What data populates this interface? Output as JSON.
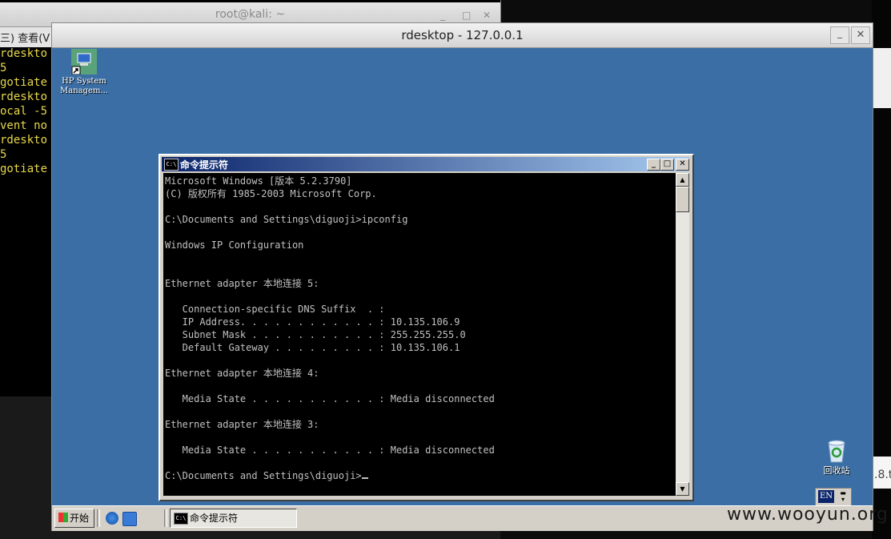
{
  "kali": {
    "title": "root@kali: ~",
    "controls": {
      "minimize": "_",
      "maximize": "□",
      "close": "✕"
    },
    "menu": "三)  查看(V",
    "lines": [
      " rdeskto",
      "5",
      "gotiate",
      " rdeskto",
      "ocal -5",
      "vent no",
      " rdeskto",
      "5",
      "gotiate"
    ]
  },
  "right_edge_text": ".8.t",
  "rdesktop": {
    "title": "rdesktop - 127.0.0.1",
    "minimize": "_",
    "close": "✕"
  },
  "desktop_icons": [
    {
      "label": "HP System Managem...",
      "icon": "hp-system-management-icon"
    },
    {
      "label": "回收站",
      "icon": "recycle-bin-icon"
    }
  ],
  "cmd": {
    "title": "命令提示符",
    "title_icon_text": "C:\\",
    "lines": [
      "Microsoft Windows [版本 5.2.3790]",
      "(C) 版权所有 1985-2003 Microsoft Corp.",
      "",
      "C:\\Documents and Settings\\diguoji>ipconfig",
      "",
      "Windows IP Configuration",
      "",
      "",
      "Ethernet adapter 本地连接 5:",
      "",
      "   Connection-specific DNS Suffix  . :",
      "   IP Address. . . . . . . . . . . . : 10.135.106.9",
      "   Subnet Mask . . . . . . . . . . . : 255.255.255.0",
      "   Default Gateway . . . . . . . . . : 10.135.106.1",
      "",
      "Ethernet adapter 本地连接 4:",
      "",
      "   Media State . . . . . . . . . . . : Media disconnected",
      "",
      "Ethernet adapter 本地连接 3:",
      "",
      "   Media State . . . . . . . . . . . : Media disconnected",
      "",
      "C:\\Documents and Settings\\diguoji>"
    ]
  },
  "taskbar": {
    "start_label": "开始",
    "task_label": "命令提示符",
    "lang": "EN"
  },
  "watermark": "www.wooyun.org",
  "colors": {
    "desktop": "#3a6ea5",
    "cmd_bg": "#000000",
    "cmd_fg": "#c0c0c0",
    "title_active": "#0a246a",
    "kali_text": "#e8d84a"
  }
}
